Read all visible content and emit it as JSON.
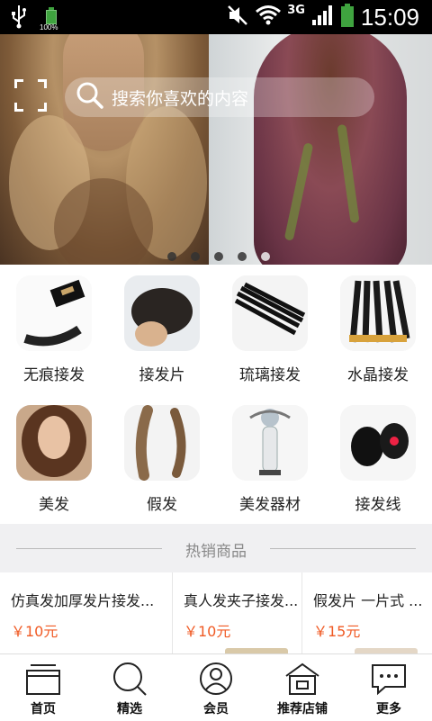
{
  "status_bar": {
    "battery_text": "100%",
    "network": "3G",
    "time": "15:09"
  },
  "search": {
    "placeholder": "搜索你喜欢的内容"
  },
  "banner": {
    "slide_count": 5,
    "active_index": 4
  },
  "categories": [
    {
      "label": "无痕接发"
    },
    {
      "label": "接发片"
    },
    {
      "label": "琉璃接发"
    },
    {
      "label": "水晶接发"
    },
    {
      "label": "美发"
    },
    {
      "label": "假发"
    },
    {
      "label": "美发器材"
    },
    {
      "label": "接发线"
    }
  ],
  "hot": {
    "title": "热销商品"
  },
  "products": [
    {
      "name": "仿真发加厚发片接发...",
      "price": "￥10元"
    },
    {
      "name": "真人发夹子接发...",
      "price": "￥10元"
    },
    {
      "name": "假发片 一片式 ...",
      "price": "￥15元"
    }
  ],
  "tabbar": [
    {
      "label": "首页"
    },
    {
      "label": "精选"
    },
    {
      "label": "会员"
    },
    {
      "label": "推荐店铺"
    },
    {
      "label": "更多"
    }
  ],
  "colors": {
    "price": "#f05a24",
    "battery": "#3fa33f"
  }
}
